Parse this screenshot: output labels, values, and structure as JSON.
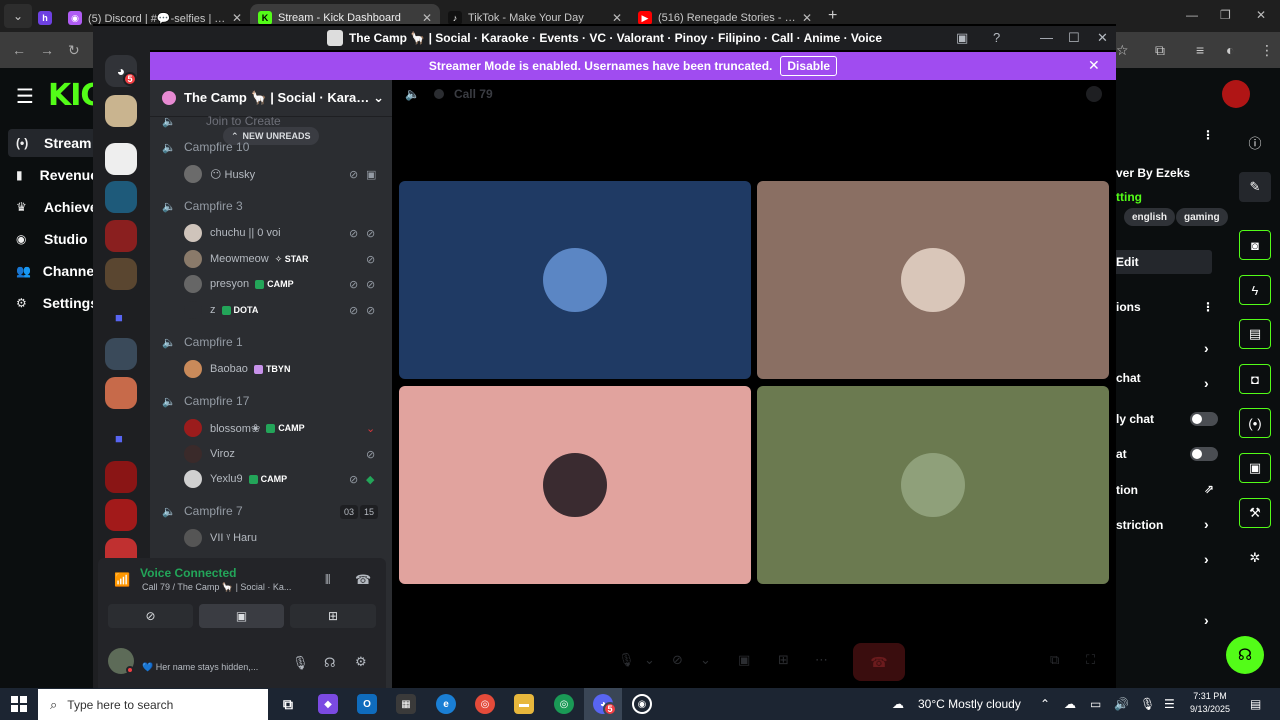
{
  "browser": {
    "tabs": [
      {
        "label": "",
        "icon": "h-icon",
        "color": "#6e41e2"
      },
      {
        "label": "(5) Discord | #💬-selfies | The C",
        "icon": "discord-icon",
        "color": "#b05cf4"
      },
      {
        "label": "Stream - Kick Dashboard",
        "icon": "K",
        "color": "#53fc18",
        "active": true
      },
      {
        "label": "TikTok - Make Your Day",
        "icon": "tiktok-icon",
        "color": "#111111"
      },
      {
        "label": "(516) Renegade Stories - MULT",
        "icon": "youtube-icon",
        "color": "#ff0000"
      }
    ],
    "newtab": "+"
  },
  "kick": {
    "logo": "KICK",
    "nav": [
      {
        "label": "Stream",
        "icon": "(•)",
        "active": true
      },
      {
        "label": "Revenue",
        "icon": "▮"
      },
      {
        "label": "Achieve",
        "icon": "🏆"
      },
      {
        "label": "Studio",
        "icon": "◉"
      },
      {
        "label": "Channel",
        "icon": "👥"
      },
      {
        "label": "Settings",
        "icon": "⚙"
      }
    ],
    "panel": {
      "title": "ver By Ezeks",
      "category": "tting",
      "tags": [
        "english",
        "gaming"
      ],
      "edit": "Edit",
      "section": "ions",
      "rows": [
        "chat",
        "ly chat",
        "at",
        "tion",
        "striction"
      ]
    }
  },
  "discord": {
    "window_title": "The Camp 🦙 | Social · Karaoke · Events · VC · Valorant · Pinoy · Filipino · Call · Anime · Voice",
    "banner_text": "Streamer Mode is enabled. Usernames have been truncated.",
    "banner_button": "Disable",
    "guild_badge": "5",
    "guild_badge_2": "5",
    "server_name": "The Camp 🦙 | Social · Karaok...",
    "join_to_create": "Join to Create",
    "new_unreads": "NEW UNREADS",
    "channels": [
      {
        "name": "Campfire 10",
        "users": [
          {
            "name": "😶 Husky",
            "av": "#6b6b6b"
          }
        ]
      },
      {
        "name": "Campfire 3",
        "users": [
          {
            "name": "chuchu || 0 voi",
            "av": "#cfc4bb"
          },
          {
            "name": "Meowmeow",
            "av": "#8a7a6a",
            "tag": "✧ STAR",
            "tagcolor": ""
          },
          {
            "name": "presyon",
            "av": "#666666",
            "tag": "CAMP",
            "tagcolor": "#23a559"
          },
          {
            "name": "z",
            "av": "#2b2d31",
            "tag": "DOTA",
            "tagcolor": "#23a559"
          }
        ]
      },
      {
        "name": "Campfire 1",
        "users": [
          {
            "name": "Baobao",
            "av": "#c98a5a",
            "tag": "TBYN",
            "tagcolor": "#c792ea"
          }
        ]
      },
      {
        "name": "Campfire 17",
        "users": [
          {
            "name": "blossom❀",
            "av": "#9b1c1c",
            "tag": "CAMP",
            "tagcolor": "#23a559"
          },
          {
            "name": "Viroz",
            "av": "#3a2a2a"
          },
          {
            "name": "Yexlu9",
            "av": "#d0d0d0",
            "tag": "CAMP",
            "tagcolor": "#23a559"
          }
        ]
      },
      {
        "name": "Campfire 7",
        "users": [
          {
            "name": "VII ᵞ Haru",
            "av": "#555555"
          }
        ],
        "counts": [
          "03",
          "15"
        ]
      }
    ],
    "voice": {
      "title": "Voice Connected",
      "subtitle": "Call 79 / The Camp 🦙 | Social · Ka...",
      "status": "💙 Her name stays hidden,..."
    },
    "call_name": "Call 79",
    "tiles": [
      {
        "bg": "#1f3a64",
        "av": "#5b86c4"
      },
      {
        "bg": "#8a6f63",
        "av": "#d9c6b9"
      },
      {
        "bg": "#e1a39e",
        "av": "#3a2b30"
      },
      {
        "bg": "#6b7a50",
        "av": "#8fa07a"
      }
    ]
  },
  "taskbar": {
    "search_placeholder": "Type here to search",
    "weather": "30°C  Mostly cloudy",
    "time": "7:31 PM",
    "date": "9/13/2025"
  }
}
